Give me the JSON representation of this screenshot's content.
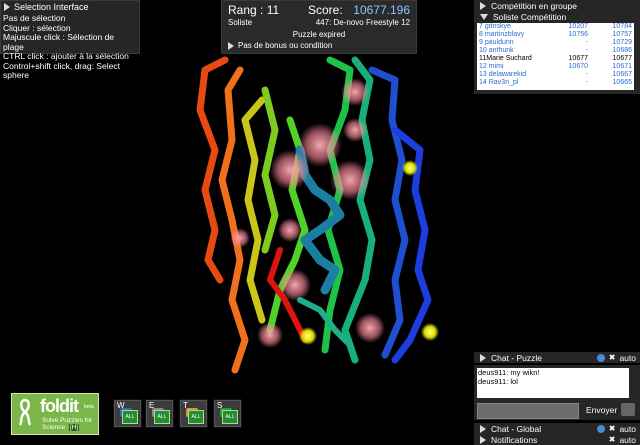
{
  "selection": {
    "title": "Selection Interface",
    "lines": [
      "Pas de sélection",
      "Cliquer : sélection",
      "Majuscule click : Sélection de plage",
      "CTRL click : ajouter à la sélection",
      "Control+shift click, drag: Select",
      "sphere"
    ]
  },
  "score": {
    "rank": "Rang : 11",
    "score_label": "Score:",
    "score_value": "10677.196",
    "mode": "Soliste",
    "puzzle": "447: De-novo Freestyle 12",
    "status": "Puzzle expired",
    "bonus": "Pas de bonus ou condition"
  },
  "right": {
    "group_tab": "Compétition en groupe",
    "solo_tab": "Soliste Compétition",
    "chat_puzzle": "Chat - Puzzle",
    "chat_global": "Chat - Global",
    "notifications": "Notifications",
    "auto": "auto",
    "send": "Envoyer"
  },
  "competition": [
    {
      "name": "7 gdnskye",
      "a": "10207",
      "b": "10784",
      "me": false
    },
    {
      "name": "8 martinzblavy",
      "a": "10756",
      "b": "10757",
      "me": false
    },
    {
      "name": "9 pauldunn",
      "a": "-",
      "b": "10729",
      "me": false
    },
    {
      "name": "10 anthunk",
      "a": "-",
      "b": "10686",
      "me": false
    },
    {
      "name": "11Marie Suchard",
      "a": "10677",
      "b": "10677",
      "me": true
    },
    {
      "name": "12 mimi",
      "a": "10670",
      "b": "10671",
      "me": false
    },
    {
      "name": "13 delawarekid",
      "a": "-",
      "b": "10667",
      "me": false
    },
    {
      "name": "14 Rav3n_pl",
      "a": "-",
      "b": "10665",
      "me": false
    }
  ],
  "chat": [
    "deus911: my wikn!",
    "deus911: lol"
  ],
  "logo": {
    "word": "foldit",
    "beta": "beta",
    "tagline": "Solve Puzzles for Science",
    "hotkey": "[H]"
  },
  "tools": [
    {
      "key": "W",
      "all": "ALL",
      "color": "#3b66c8"
    },
    {
      "key": "E",
      "all": "ALL",
      "color": "#8a8a8a"
    },
    {
      "key": "T",
      "all": "ALL",
      "color": "#d9992a"
    },
    {
      "key": "S",
      "all": "ALL",
      "color": "#2c9c3b"
    }
  ]
}
